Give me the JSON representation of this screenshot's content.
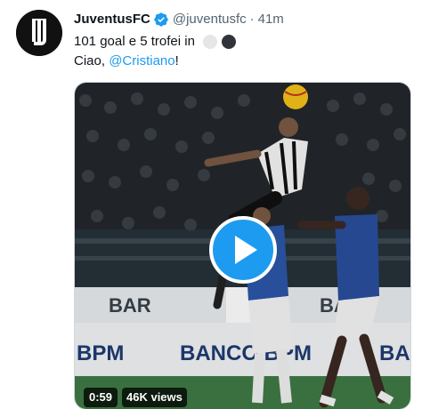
{
  "tweet": {
    "author": {
      "display_name": "JuventusFC",
      "handle": "@juventusfc",
      "verified": true,
      "avatar_icon": "juventus-logo"
    },
    "separator": "·",
    "time": "41m",
    "text_line1": "101 goal e 5 trofei in",
    "emojis": [
      "white-circle",
      "black-circle"
    ],
    "text_line2_prefix": "Ciao, ",
    "mention": "@Cristiano",
    "text_line2_suffix": "!",
    "colors": {
      "accent": "#1d9bf0",
      "text": "#0f1419",
      "secondary": "#536471"
    }
  },
  "video": {
    "duration": "0:59",
    "views": "46K views",
    "play_icon": "play-icon",
    "background_signs": {
      "left_board": "BAR",
      "right_board": "BAR",
      "sponsor_left": "BPM",
      "sponsor_center": "BANCO BPM",
      "sponsor_right": "BA"
    }
  }
}
